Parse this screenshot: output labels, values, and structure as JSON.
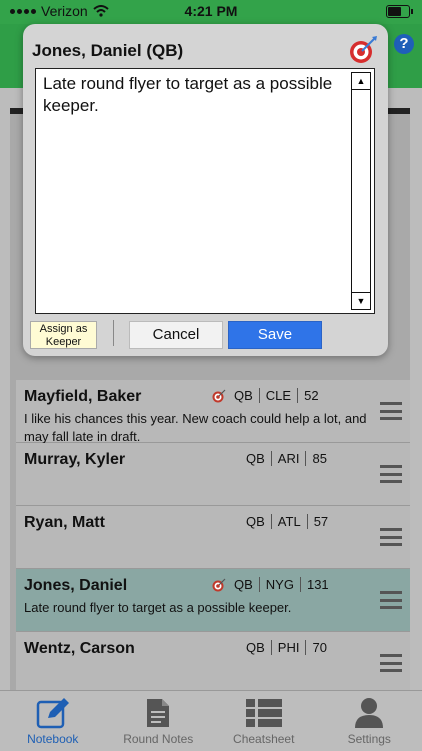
{
  "status_bar": {
    "carrier": "Verizon",
    "time": "4:21 PM"
  },
  "modal": {
    "title": "Jones, Daniel (QB)",
    "note_text": "Late round flyer to target as a possible keeper.",
    "assign_line1": "Assign as",
    "assign_line2": "Keeper",
    "cancel_label": "Cancel",
    "save_label": "Save"
  },
  "players": [
    {
      "name": "Mayfield, Baker",
      "pos": "QB",
      "team": "CLE",
      "num": "52",
      "note": "I like his chances this year. New coach could help a lot, and may fall late in draft.",
      "target": true
    },
    {
      "name": "Murray, Kyler",
      "pos": "QB",
      "team": "ARI",
      "num": "85",
      "note": "",
      "target": false
    },
    {
      "name": "Ryan, Matt",
      "pos": "QB",
      "team": "ATL",
      "num": "57",
      "note": "",
      "target": false
    },
    {
      "name": "Jones, Daniel",
      "pos": "QB",
      "team": "NYG",
      "num": "131",
      "note": "Late round flyer to target as a possible keeper.",
      "target": true
    },
    {
      "name": "Wentz, Carson",
      "pos": "QB",
      "team": "PHI",
      "num": "70",
      "note": "",
      "target": false
    }
  ],
  "tabs": [
    {
      "label": "Notebook",
      "icon": "notebook-icon"
    },
    {
      "label": "Round Notes",
      "icon": "document-icon"
    },
    {
      "label": "Cheatsheet",
      "icon": "list-icon"
    },
    {
      "label": "Settings",
      "icon": "person-icon"
    }
  ],
  "colors": {
    "header_green": "#2f9e47",
    "save_blue": "#2f74e8",
    "active_tab": "#1e5fb4",
    "selected_row": "#8aa7a3"
  }
}
